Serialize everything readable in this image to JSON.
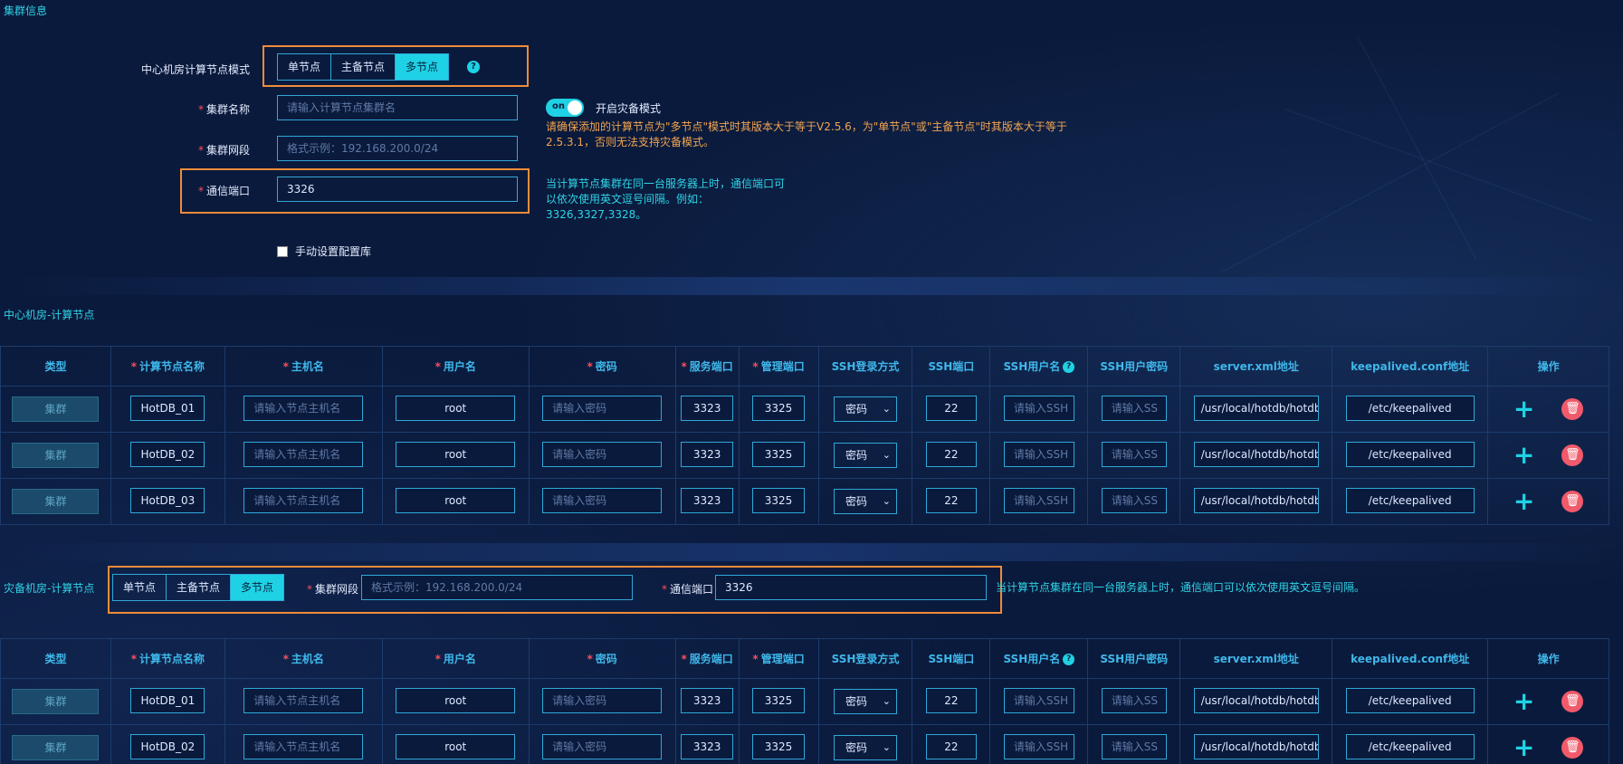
{
  "cluster_section": {
    "title": "集群信息",
    "mode_label": "中心机房计算节点模式",
    "modes": [
      "单节点",
      "主备节点",
      "多节点"
    ],
    "active_mode": "多节点",
    "name_label": "集群名称",
    "name_placeholder": "请输入计算节点集群名",
    "segment_label": "集群网段",
    "segment_placeholder": "格式示例：192.168.200.0/24",
    "port_label": "通信端口",
    "port_value": "3326",
    "dr_toggle_on": "on",
    "dr_toggle_label": "开启灾备模式",
    "dr_warning_1": "请确保添加的计算节点为\"多节点\"模式时其版本大于等于V2.5.6，为\"单节点\"或\"主备节点\"时其版本大于等于",
    "dr_warning_2": "2.5.3.1，否则无法支持灾备模式。",
    "port_hint_1": "当计算节点集群在同一台服务器上时，通信端口可",
    "port_hint_2": "以依次使用英文逗号间隔。例如：",
    "port_hint_3": "3326,3327,3328。",
    "manual_config_label": "手动设置配置库"
  },
  "center_section": {
    "title": "中心机房-计算节点"
  },
  "dr_section": {
    "title": "灾备机房-计算节点",
    "modes": [
      "单节点",
      "主备节点",
      "多节点"
    ],
    "active_mode": "多节点",
    "segment_label": "集群网段",
    "segment_placeholder": "格式示例：192.168.200.0/24",
    "port_label": "通信端口",
    "port_value": "3326",
    "port_hint": "当计算节点集群在同一台服务器上时，通信端口可以依次使用英文逗号间隔。"
  },
  "table_headers": [
    "类型",
    "计算节点名称",
    "主机名",
    "用户名",
    "密码",
    "服务端口",
    "管理端口",
    "SSH登录方式",
    "SSH端口",
    "SSH用户名",
    "SSH用户密码",
    "server.xml地址",
    "keepalived.conf地址",
    "操作"
  ],
  "required_headers": [
    1,
    2,
    3,
    4,
    5,
    6
  ],
  "placeholders": {
    "host": "请输入节点主机名",
    "password": "请输入密码",
    "ssh_user": "请输入SSH",
    "ssh_pass": "请输入SS"
  },
  "center_rows": [
    {
      "type": "集群",
      "name": "HotDB_01",
      "user": "root",
      "service_port": "3323",
      "manage_port": "3325",
      "ssh_method": "密码",
      "ssh_port": "22",
      "server_xml": "/usr/local/hotdb/hotdb",
      "keepalived": "/etc/keepalived"
    },
    {
      "type": "集群",
      "name": "HotDB_02",
      "user": "root",
      "service_port": "3323",
      "manage_port": "3325",
      "ssh_method": "密码",
      "ssh_port": "22",
      "server_xml": "/usr/local/hotdb/hotdb",
      "keepalived": "/etc/keepalived"
    },
    {
      "type": "集群",
      "name": "HotDB_03",
      "user": "root",
      "service_port": "3323",
      "manage_port": "3325",
      "ssh_method": "密码",
      "ssh_port": "22",
      "server_xml": "/usr/local/hotdb/hotdb",
      "keepalived": "/etc/keepalived"
    }
  ],
  "dr_rows": [
    {
      "type": "集群",
      "name": "HotDB_01",
      "user": "root",
      "service_port": "3323",
      "manage_port": "3325",
      "ssh_method": "密码",
      "ssh_port": "22",
      "server_xml": "/usr/local/hotdb/hotdb",
      "keepalived": "/etc/keepalived"
    },
    {
      "type": "集群",
      "name": "HotDB_02",
      "user": "root",
      "service_port": "3323",
      "manage_port": "3325",
      "ssh_method": "密码",
      "ssh_port": "22",
      "server_xml": "/usr/local/hotdb/hotdb",
      "keepalived": "/etc/keepalived"
    }
  ],
  "colors": {
    "background": "#0a1a3c",
    "accent": "#1fd1e4",
    "highlight_box": "#f08c3a",
    "warning": "#f2a450",
    "required": "#ff4d5a",
    "delete": "#f05a6a"
  }
}
